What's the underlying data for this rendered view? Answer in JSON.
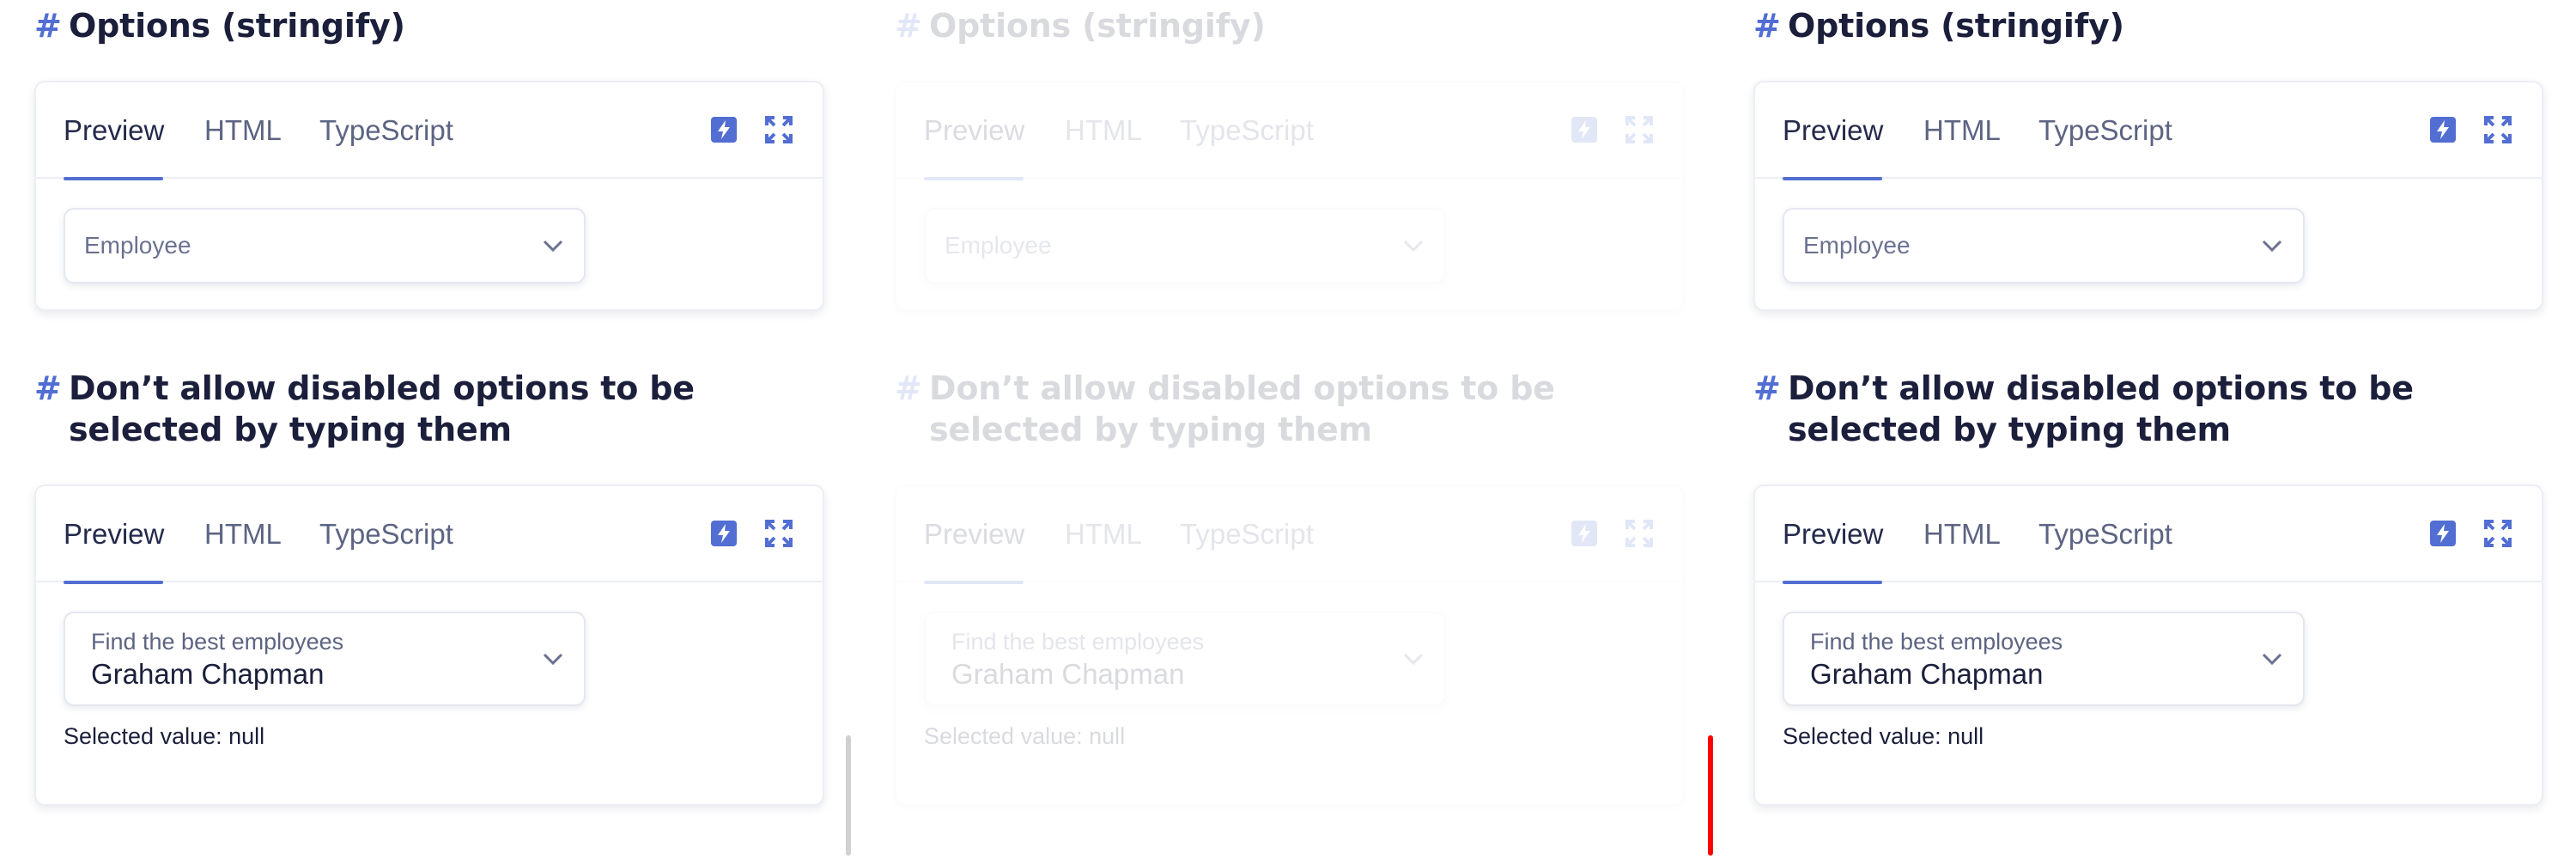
{
  "sections": {
    "options_stringify": {
      "hash": "#",
      "title": "Options (stringify)"
    },
    "disabled_typing": {
      "hash": "#",
      "title": "Don’t allow disabled options to be selected by typing them"
    }
  },
  "tabs": {
    "preview": "Preview",
    "html": "HTML",
    "typescript": "TypeScript"
  },
  "toolbar": {
    "stackblitz_icon": "lightning-bolt-icon",
    "fullscreen_icon": "expand-icon"
  },
  "example1": {
    "select_placeholder": "Employee"
  },
  "example2": {
    "select_label": "Find the best employees",
    "select_value": "Graham Chapman",
    "selected_value_text": "Selected value: null"
  },
  "colors": {
    "accent": "#526ed3",
    "scrollbar_red": "#ff0000",
    "scrollbar_grey": "#d0d0d0"
  }
}
